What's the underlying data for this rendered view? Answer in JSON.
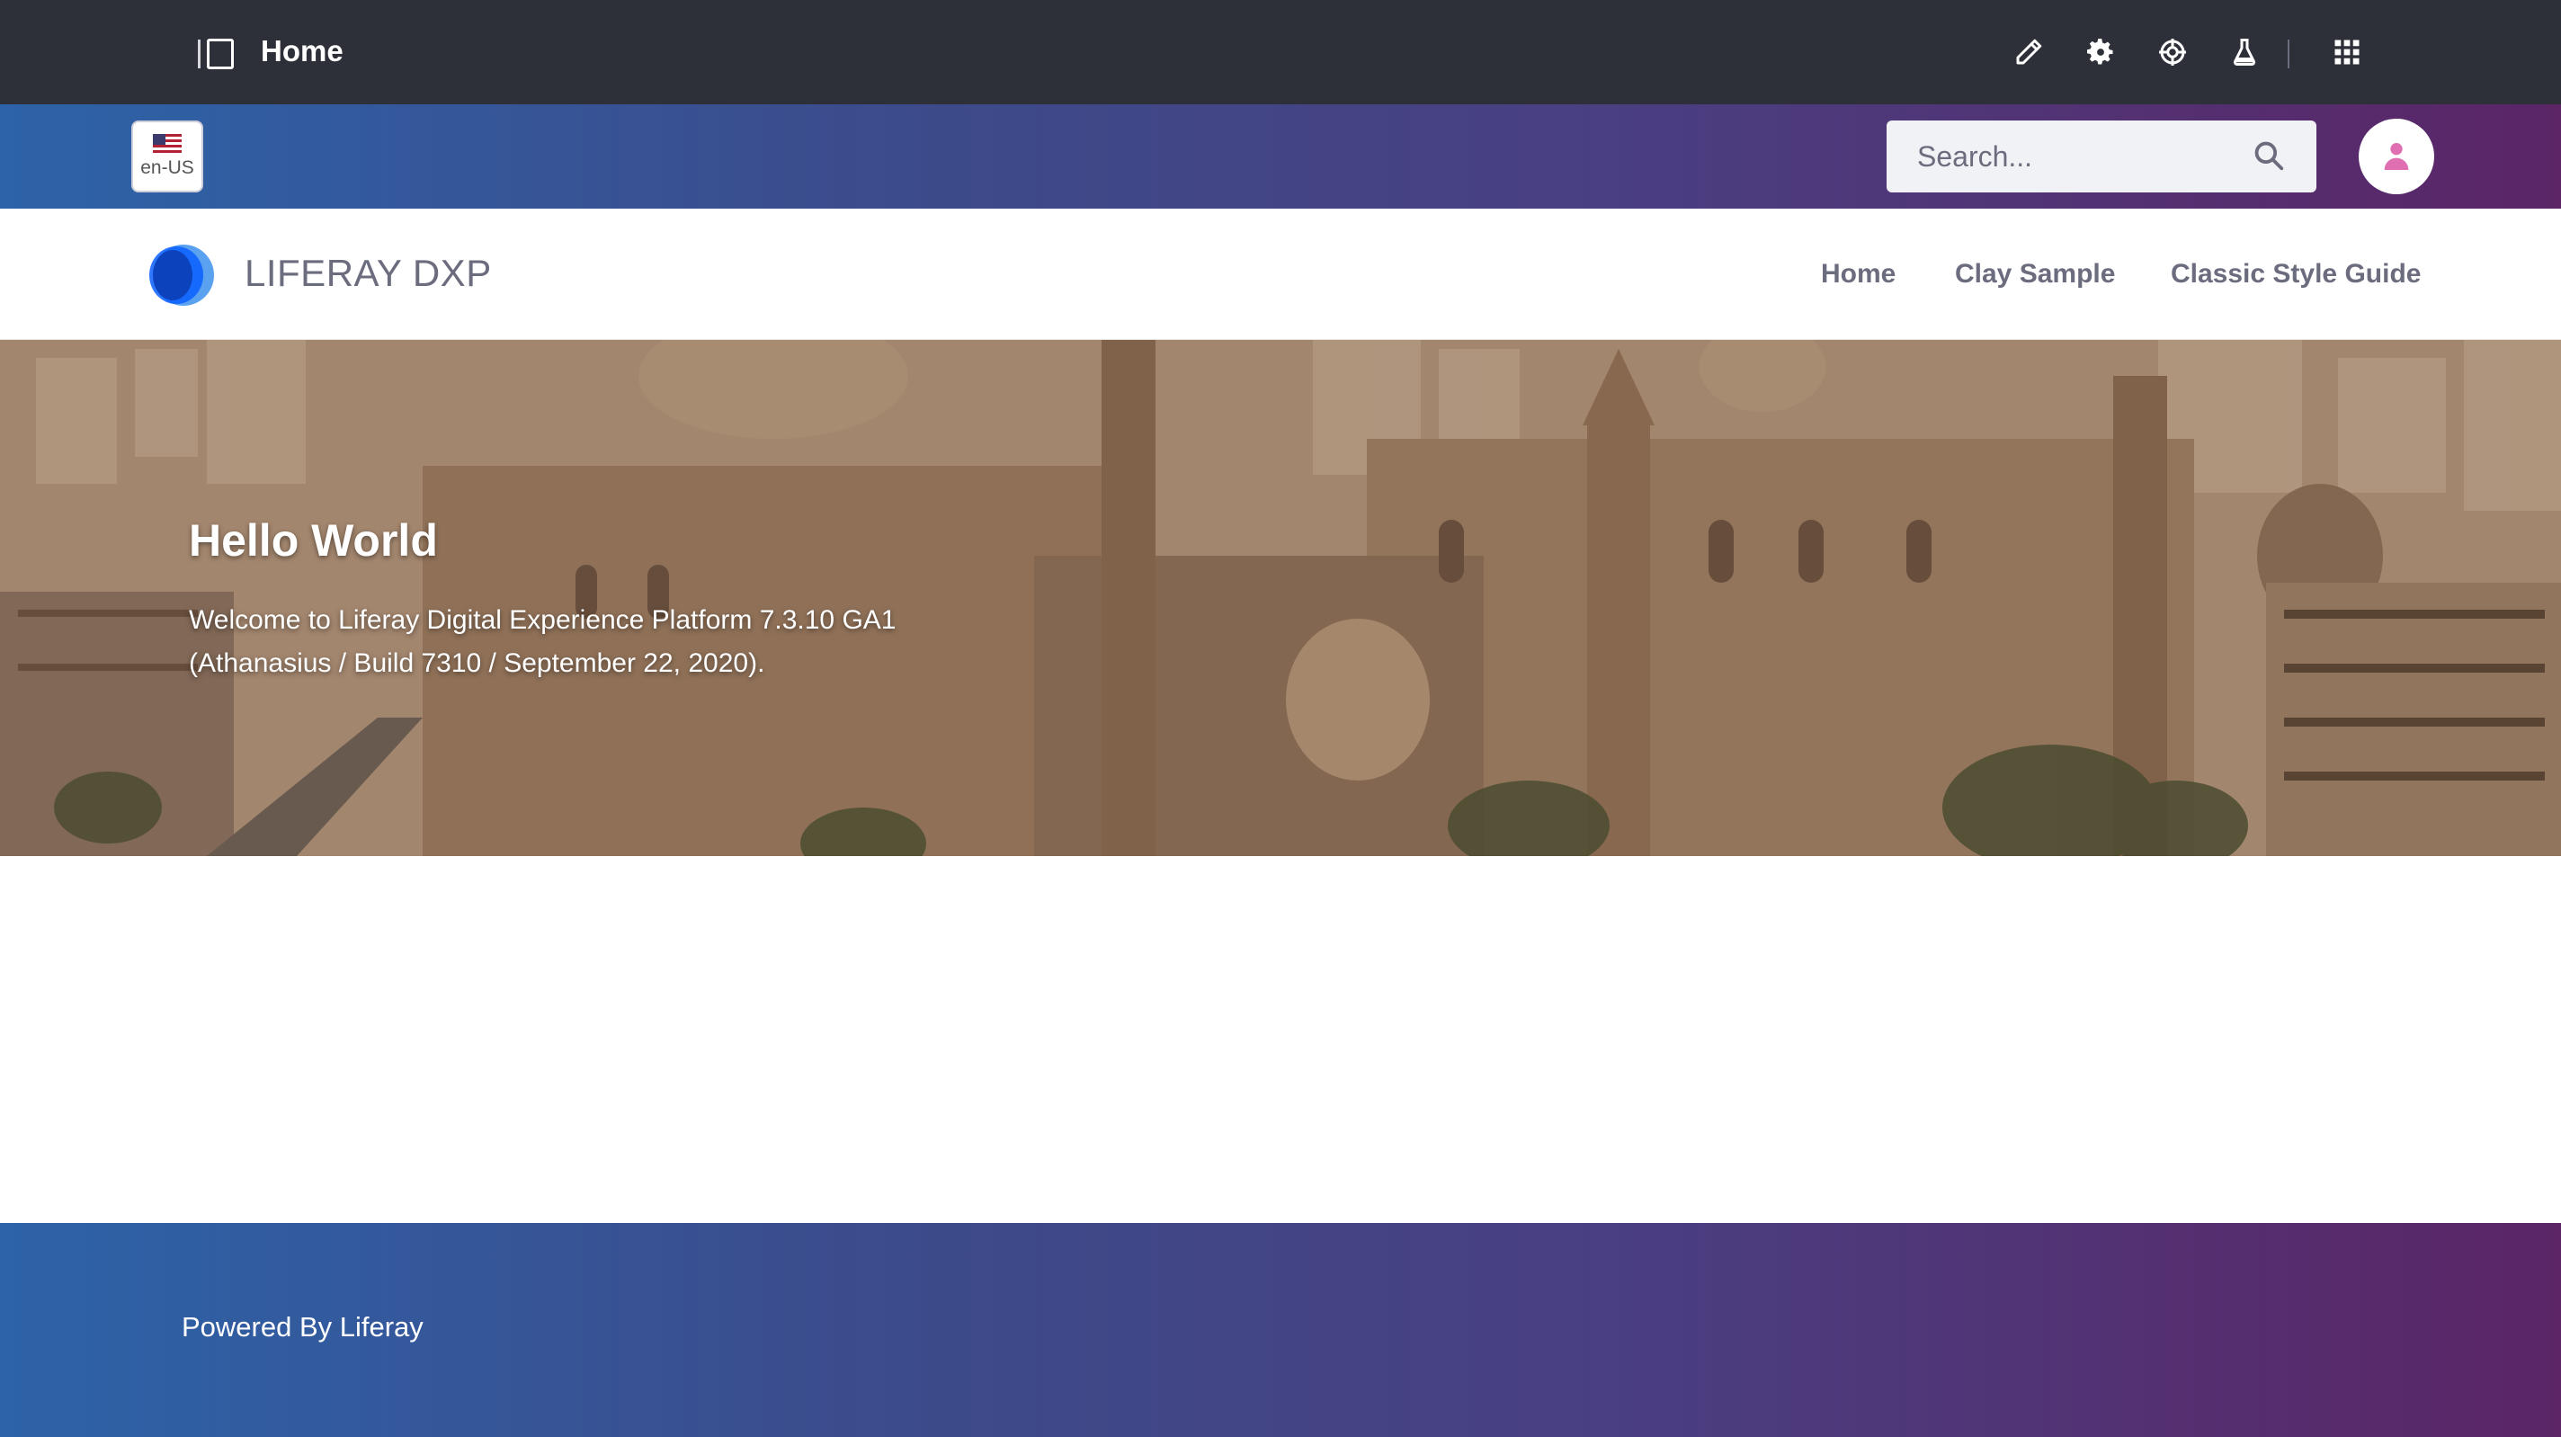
{
  "control_menu": {
    "title": "Home",
    "icons": [
      "pencil-icon",
      "gear-icon",
      "target-icon",
      "flask-icon",
      "apps-grid-icon"
    ]
  },
  "header": {
    "language": {
      "label": "en-US",
      "flag": "us-flag-icon"
    },
    "search": {
      "placeholder": "Search..."
    },
    "user_avatar": "user-icon"
  },
  "navbar": {
    "site_name": "LIFERAY DXP",
    "items": [
      {
        "label": "Home"
      },
      {
        "label": "Clay Sample"
      },
      {
        "label": "Classic Style Guide"
      }
    ]
  },
  "hero": {
    "title": "Hello World",
    "text": "Welcome to Liferay Digital Experience Platform 7.3.10 GA1 (Athanasius / Build 7310 / September 22, 2020)."
  },
  "footer": {
    "text": "Powered By Liferay"
  },
  "colors": {
    "control_menu_bg": "#2e3039",
    "gradient_start": "#2d63a8",
    "gradient_end": "#5b2566",
    "nav_text": "#6b6c7e",
    "avatar_accent": "#e06fb2",
    "logo_blue": "#0b5fff"
  }
}
